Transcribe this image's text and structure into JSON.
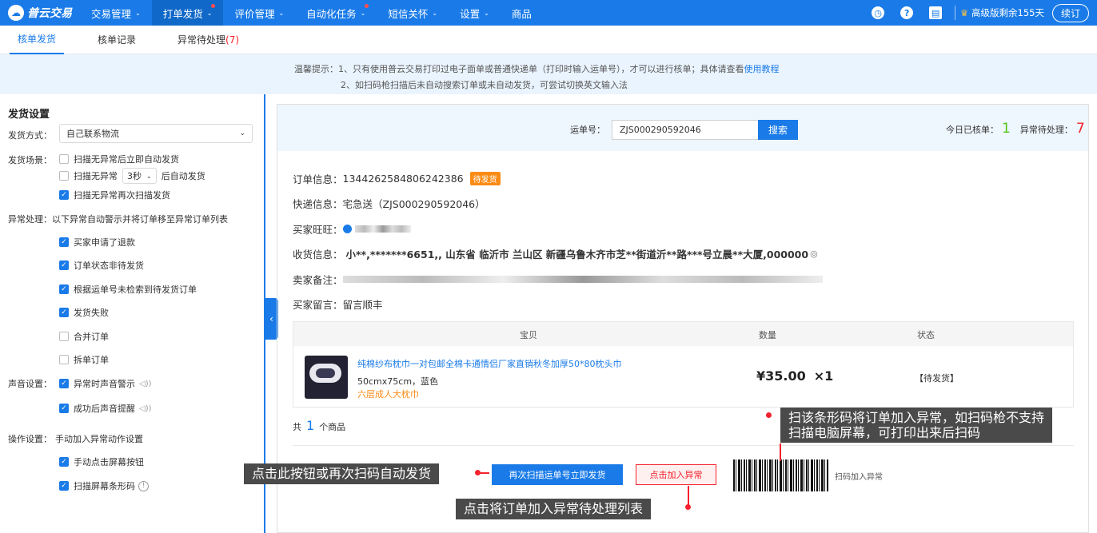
{
  "nav": {
    "brand": "普云交易",
    "items": [
      {
        "label": "交易管理",
        "caret": "⌄",
        "active": false,
        "dot": false
      },
      {
        "label": "打单发货",
        "caret": "⌄",
        "active": true,
        "dot": true
      },
      {
        "label": "评价管理",
        "caret": "⌄",
        "active": false,
        "dot": false
      },
      {
        "label": "自动化任务",
        "caret": "⌄",
        "active": false,
        "dot": true
      },
      {
        "label": "短信关怀",
        "caret": "⌄",
        "active": false,
        "dot": false
      },
      {
        "label": "设置",
        "caret": "⌄",
        "active": false,
        "dot": false
      },
      {
        "label": "商品",
        "caret": "",
        "active": false,
        "dot": false
      }
    ],
    "plan": "高级版剩余155天",
    "renew": "续订"
  },
  "subtabs": {
    "t1": "核单发货",
    "t2": "核单记录",
    "t3": "异常待处理",
    "t3_count": "(7)"
  },
  "notice": {
    "line1": "温馨提示：1、只有使用普云交易打印过电子面单或普通快递单（打印时输入运单号），才可以进行核单；具体请查看",
    "line1_link": "使用教程",
    "line2": "2、如扫码枪扫描后未自动搜索订单或未自动发货，可尝试切换英文输入法"
  },
  "settings": {
    "title": "发货设置",
    "ship_method_label": "发货方式：",
    "ship_method_value": "自己联系物流",
    "scene_label": "发货场景：",
    "scene1": "扫描无异常后立即自动发货",
    "scene2_prefix": "扫描无异常",
    "scene2_select": "3秒",
    "scene2_suffix": "后自动发货",
    "scene3": "扫描无异常再次扫描发货",
    "abnormal_label": "异常处理：",
    "abnormal_desc": "以下异常自动警示并将订单移至异常订单列表",
    "ab1": "买家申请了退款",
    "ab2": "订单状态非待发货",
    "ab3": "根据运单号未检索到待发货订单",
    "ab4": "发货失败",
    "ab5": "合并订单",
    "ab6": "拆单订单",
    "sound_label": "声音设置：",
    "sound1": "异常时声音警示",
    "sound2": "成功后声音提醒",
    "op_label": "操作设置：",
    "op_desc": "手动加入异常动作设置",
    "op1": "手动点击屏幕按钮",
    "op2": "扫描屏幕条形码"
  },
  "search": {
    "label": "运单号：",
    "value": "ZJS000290592046",
    "button": "搜索",
    "today_label": "今日已核单：",
    "today_count": "1",
    "abnormal_label": "异常待处理：",
    "abnormal_count": "7"
  },
  "order": {
    "info_label": "订单信息：",
    "order_id": "1344262584806242386",
    "status_badge": "待发货",
    "express_label": "快递信息：",
    "express_value": "宅急送（ZJS000290592046）",
    "buyer_label": "买家旺旺：",
    "receiver_label": "收货信息：",
    "receiver_value": "小**,*******6651,, 山东省 临沂市 兰山区 新疆乌鲁木齐市芝**街道沂**路***号立晨**大厦,000000",
    "seller_note_label": "卖家备注：",
    "buyer_msg_label": "买家留言：",
    "buyer_msg_value": "留言顺丰"
  },
  "product_table": {
    "headers": [
      "宝贝",
      "数量",
      "状态"
    ],
    "item": {
      "name": "纯棉纱布枕巾一对包邮全棉卡通情侣厂家直销秋冬加厚50*80枕头巾",
      "spec": "50cmx75cm，蓝色",
      "tag": "六层成人大枕巾",
      "price": "¥35.00",
      "qty": "×1",
      "status": "【待发货】"
    }
  },
  "summary": {
    "prefix": "共",
    "count": "1",
    "suffix": "个商品"
  },
  "actions": {
    "ship_button": "再次扫描运单号立即发货",
    "abnormal_button": "点击加入异常",
    "barcode_label": "扫码加入异常"
  },
  "annotations": {
    "tip1": "点击此按钮或再次扫码自动发货",
    "tip2": "点击将订单加入异常待处理列表",
    "tip3_line1": "扫该条形码将订单加入异常，如扫码枪不支持",
    "tip3_line2": "扫描电脑屏幕，可打印出来后扫码"
  },
  "colors": {
    "primary": "#1a7be8",
    "danger": "#f5222d",
    "success": "#52c41a",
    "warning": "#fa8c16"
  }
}
